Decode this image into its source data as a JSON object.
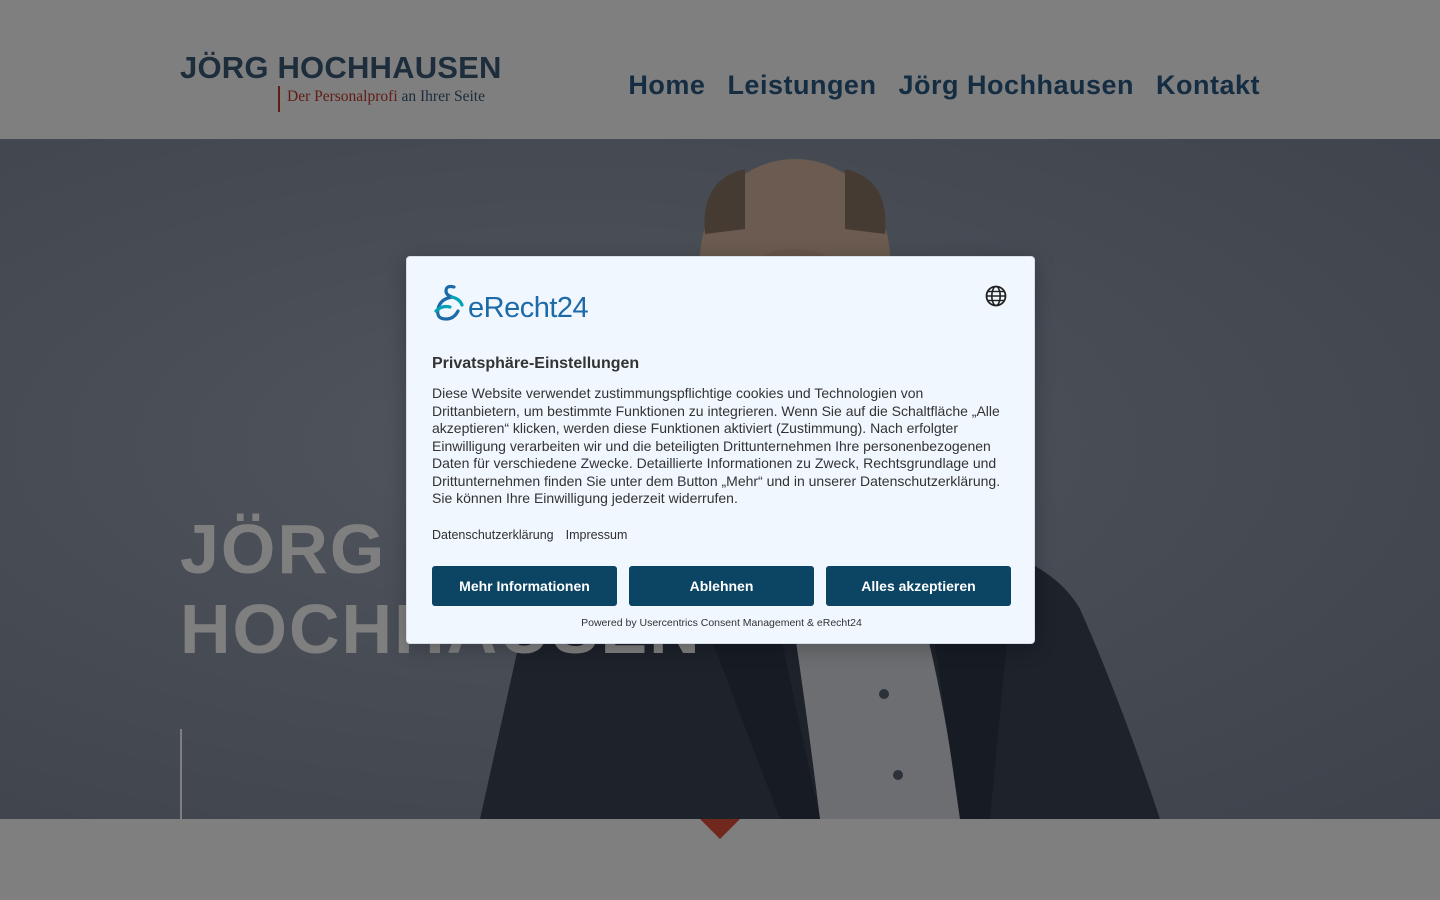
{
  "header": {
    "logo_title": "JÖRG HOCHHAUSEN",
    "logo_tagline_accent": "Der Personalprofi",
    "logo_tagline_rest": " an Ihrer Seite",
    "nav": [
      {
        "label": "Home"
      },
      {
        "label": "Leistungen"
      },
      {
        "label": "Jörg Hochhausen"
      },
      {
        "label": "Kontakt"
      }
    ]
  },
  "hero": {
    "title_line1": "JÖRG",
    "title_line2": "HOCHHAUSEN"
  },
  "consent": {
    "brand": "eRecht24",
    "title": "Privatsphäre-Einstellungen",
    "body": "Diese Website verwendet zustimmungspflichtige cookies und Technologien von Drittanbietern, um bestimmte Funktionen zu integrieren. Wenn Sie auf die Schaltfläche „Alle akzeptieren“ klicken, werden diese Funktionen aktiviert (Zustimmung). Nach erfolgter Einwilligung verarbeiten wir und die beteiligten Drittunternehmen Ihre personenbezogenen Daten für verschiedene Zwecke. Detaillierte Informationen zu Zweck, Rechtsgrundlage und Drittunternehmen finden Sie unter dem Button „Mehr“ und in unserer Datenschutzerklärung. Sie können Ihre Einwilligung jederzeit widerrufen.",
    "links": [
      {
        "label": "Datenschutzerklärung"
      },
      {
        "label": "Impressum"
      }
    ],
    "buttons": {
      "more": "Mehr Informationen",
      "deny": "Ablehnen",
      "accept_all": "Alles akzeptieren"
    },
    "powered_by": "Powered by Usercentrics Consent Management & eRecht24",
    "language_icon": "globe-icon"
  },
  "colors": {
    "brand_blue": "#2b5b85",
    "accent_red": "#c0392b",
    "button_bg": "#0b4563",
    "dialog_bg": "#f0f7ff"
  }
}
